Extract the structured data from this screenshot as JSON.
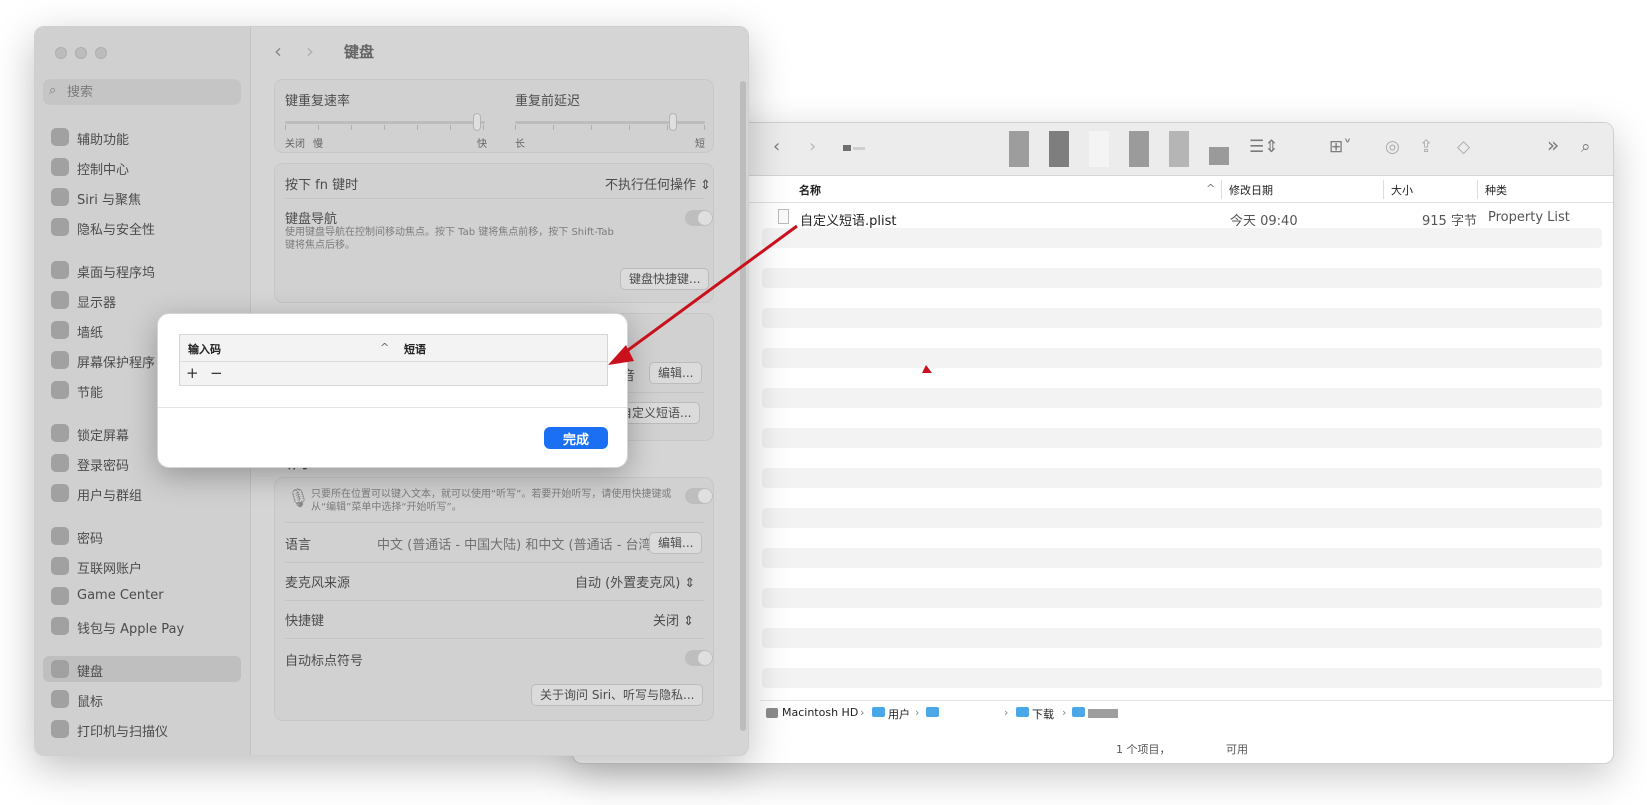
{
  "settings": {
    "search_placeholder": "搜索",
    "title": "键盘",
    "sidebar": [
      {
        "label": "辅助功能"
      },
      {
        "label": "控制中心"
      },
      {
        "label": "Siri 与聚焦"
      },
      {
        "label": "隐私与安全性"
      },
      {
        "label": "桌面与程序坞"
      },
      {
        "label": "显示器"
      },
      {
        "label": "墙纸"
      },
      {
        "label": "屏幕保护程序"
      },
      {
        "label": "节能"
      },
      {
        "label": "锁定屏幕"
      },
      {
        "label": "登录密码"
      },
      {
        "label": "用户与群组"
      },
      {
        "label": "密码"
      },
      {
        "label": "互联网账户"
      },
      {
        "label": "Game Center"
      },
      {
        "label": "钱包与 Apple Pay"
      },
      {
        "label": "键盘"
      },
      {
        "label": "鼠标"
      },
      {
        "label": "打印机与扫描仪"
      }
    ],
    "repeat_rate": {
      "label": "键重复速率",
      "left": "关闭",
      "left2": "慢",
      "right": "快",
      "value": 0.96
    },
    "repeat_delay": {
      "label": "重复前延迟",
      "left": "长",
      "right": "短",
      "value": 0.83
    },
    "fn_key": {
      "label": "按下 fn 键时",
      "value": "不执行任何操作"
    },
    "keyboard_nav": {
      "label": "键盘导航",
      "desc1": "使用键盘导航在控制间移动焦点。按下 Tab 键将焦点前移，按下 Shift-Tab",
      "desc2": "键将焦点后移。",
      "on": false
    },
    "shortcuts_btn": "键盘快捷键...",
    "input_partial": "拼音",
    "edit_btn": "编辑...",
    "text_replace_btn": "自定义短语...",
    "dictation": {
      "section": "听写",
      "desc1": "只要所在位置可以键入文本，就可以使用“听写”。若要开始听写，请使用快捷键或",
      "desc2": "从“编辑”菜单中选择“开始听写”。",
      "language_label": "语言",
      "language_value": "中文 (普通话 - 中国大陆) 和中文 (普通话 - 台湾)",
      "language_btn": "编辑...",
      "mic_label": "麦克风来源",
      "mic_value": "自动 (外置麦克风)",
      "shortcut_label": "快捷键",
      "shortcut_value": "关闭",
      "auto_punct_label": "自动标点符号",
      "privacy_btn": "关于询问 Siri、听写与隐私..."
    }
  },
  "dialog": {
    "col1": "输入码",
    "col2": "短语",
    "add": "+",
    "remove": "−",
    "done": "完成"
  },
  "finder": {
    "columns": {
      "name": "名称",
      "modified": "修改日期",
      "size": "大小",
      "kind": "种类"
    },
    "file": {
      "name": "自定义短语.plist",
      "modified": "今天 09:40",
      "size": "915 字节",
      "kind": "Property List"
    },
    "path": {
      "disk": "Macintosh HD",
      "users": "用户",
      "downloads": "下载"
    },
    "status": {
      "items": "1 个项目，",
      "available": "可用"
    }
  },
  "colors": {
    "accent": "#1a6ff2",
    "arrow": "#c8111c",
    "folder": "#4aa8e8"
  }
}
